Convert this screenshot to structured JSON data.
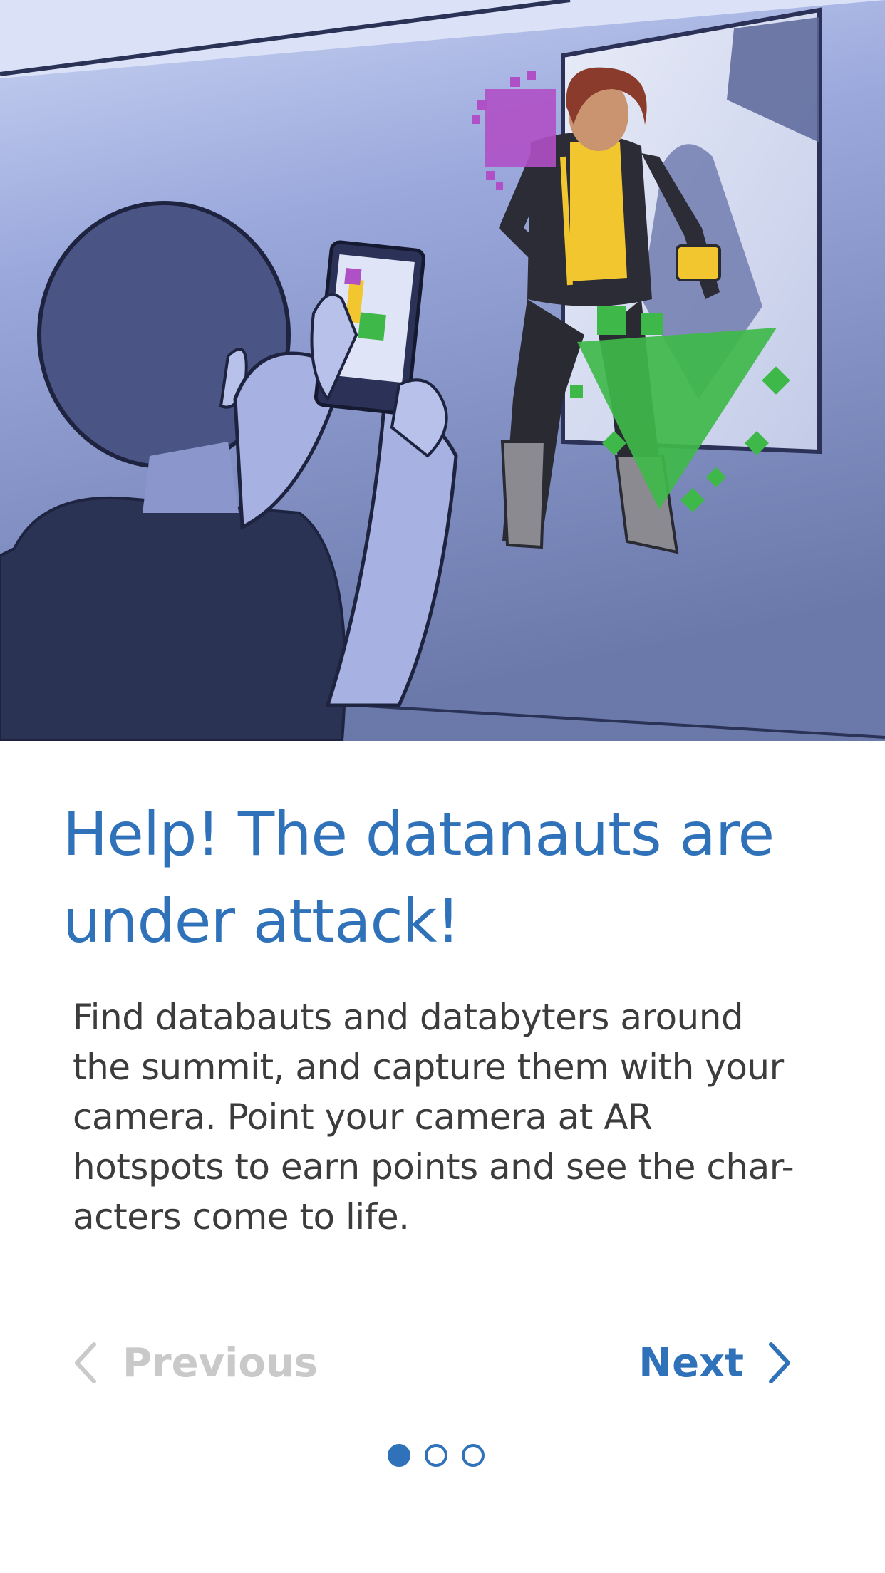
{
  "onboarding": {
    "title": "Help! The datanauts are under attack!",
    "body": "Find databauts and databyters around\nthe summit, and capture them with your\ncamera.  Point your camera at AR\nhotspots to earn points and see the char-\nacters come to life.",
    "current_page": 1,
    "total_pages": 3
  },
  "nav": {
    "previous_label": "Previous",
    "previous_enabled": false,
    "next_label": "Next",
    "next_enabled": true
  },
  "colors": {
    "accent": "#2f72b9",
    "disabled": "#c9c9c9",
    "body_text": "#3c3c3c"
  },
  "icons": {
    "previous": "chevron-left-icon",
    "next": "chevron-right-icon"
  }
}
